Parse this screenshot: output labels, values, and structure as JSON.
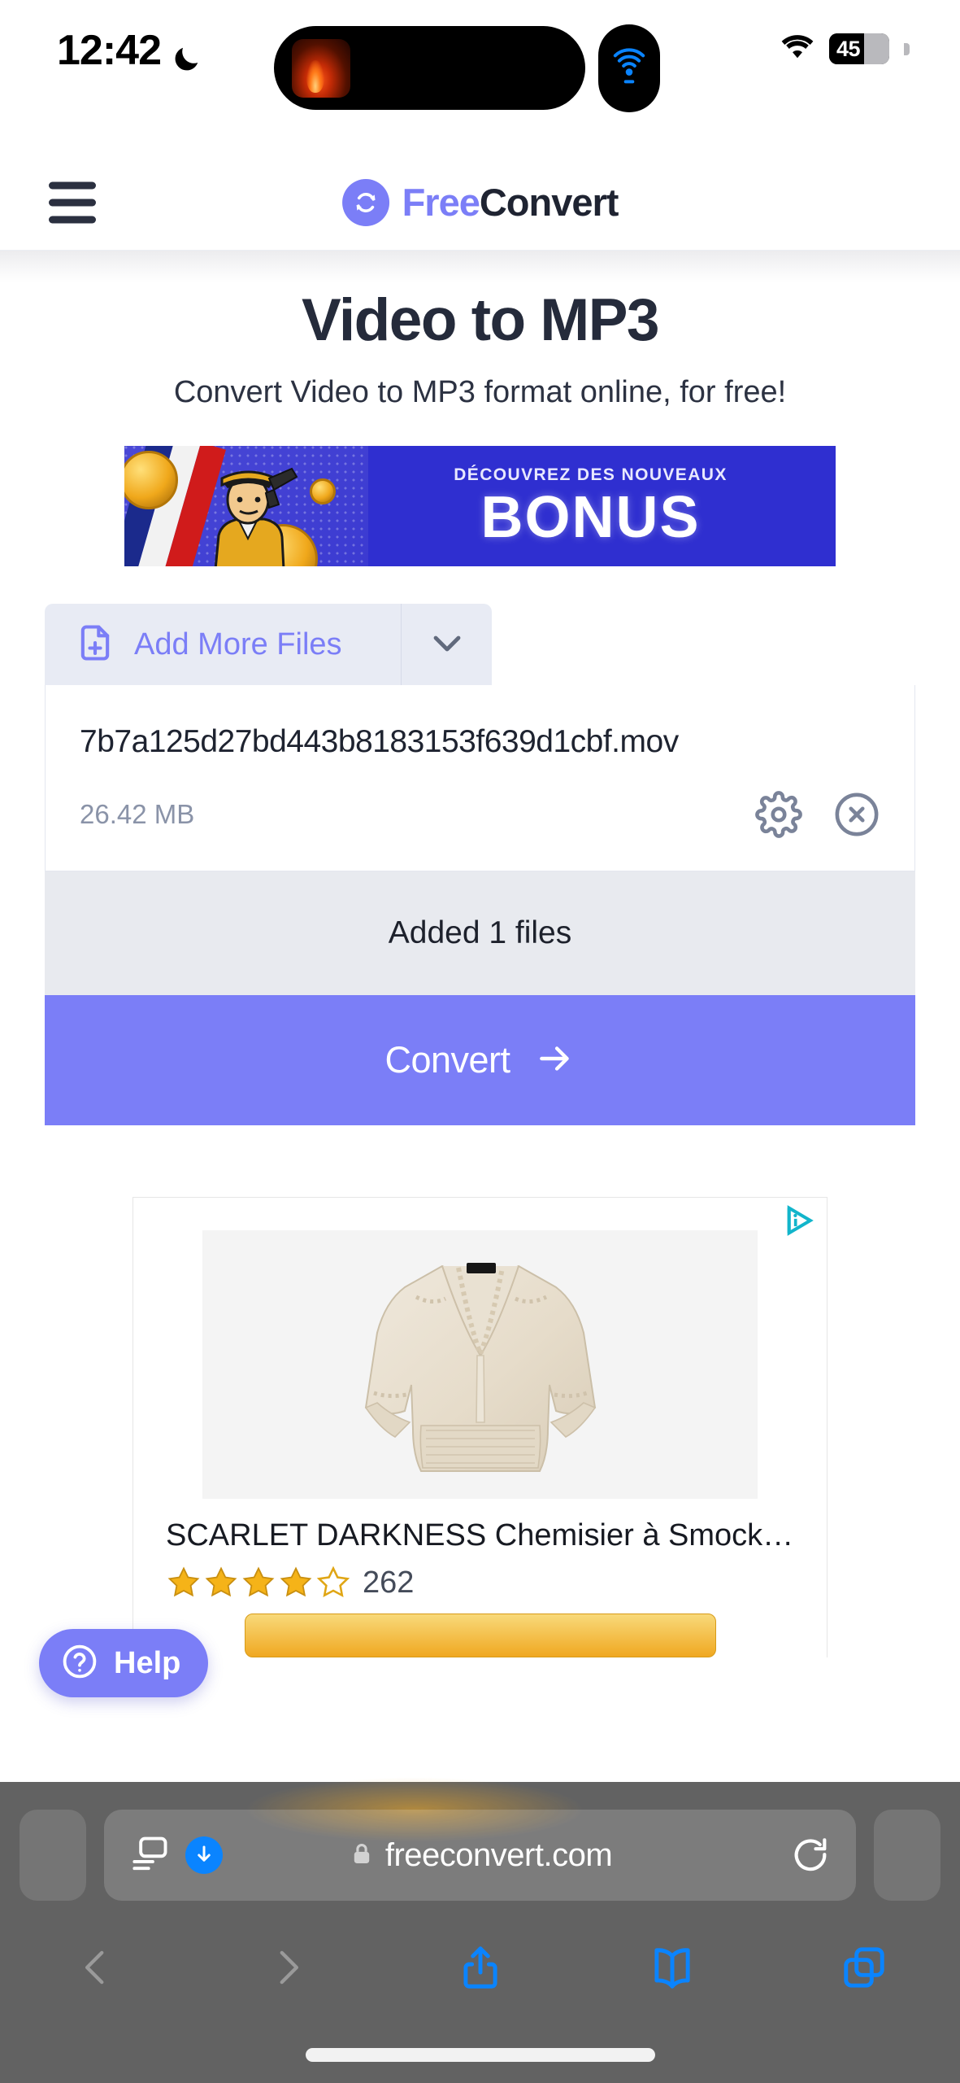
{
  "status_bar": {
    "time": "12:42",
    "dnd_icon": "crescent-moon-icon",
    "airplay_icon": "airplay-broadcast-icon",
    "wifi_icon": "wifi-icon",
    "battery_percent": "45"
  },
  "site_header": {
    "menu_icon": "hamburger-menu-icon",
    "logo_icon": "refresh-circle-icon",
    "brand_first": "Free",
    "brand_second": "Convert"
  },
  "hero": {
    "title": "Video to MP3",
    "subtitle": "Convert Video to MP3 format online, for free!"
  },
  "banner_ad": {
    "kicker": "DÉCOUVREZ DES NOUVEAUX",
    "title": "BONUS"
  },
  "converter": {
    "add_more_files_label": "Add More Files",
    "add_file_icon": "file-plus-icon",
    "caret_icon": "chevron-down-icon",
    "file": {
      "name": "7b7a125d27bd443b8183153f639d1cbf.mov",
      "size": "26.42 MB",
      "settings_icon": "gear-icon",
      "remove_icon": "close-circle-icon"
    },
    "status_text": "Added 1 files",
    "convert_label": "Convert",
    "convert_arrow_icon": "arrow-right-icon"
  },
  "product_ad": {
    "adchoices_icon": "adchoices-icon",
    "title": "SCARLET DARKNESS Chemisier à Smock…",
    "stars_filled": 4,
    "stars_total": 5,
    "review_count": "262"
  },
  "help_button": {
    "icon": "question-circle-icon",
    "label": "Help"
  },
  "browser": {
    "reader_icon": "reader-view-icon",
    "download_icon": "download-arrow-icon",
    "lock_icon": "lock-icon",
    "url": "freeconvert.com",
    "reload_icon": "reload-icon",
    "back_icon": "chevron-left-icon",
    "forward_icon": "chevron-right-icon",
    "share_icon": "share-icon",
    "bookmarks_icon": "book-icon",
    "tabs_icon": "tabs-icon"
  },
  "colors": {
    "accent_purple": "#7b7ef7",
    "ad_blue": "#2f2fd0",
    "safari_blue": "#0a84ff",
    "star_gold": "#f5b318"
  }
}
